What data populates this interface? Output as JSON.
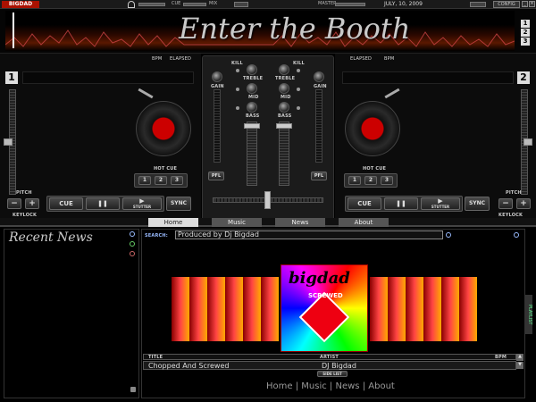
{
  "app": {
    "logo": "BIGDAD",
    "title": "Enter the Booth"
  },
  "topbar": {
    "cue_label": "CUE",
    "mix_label": "MIX",
    "master_label": "MASTER",
    "date": "JULY, 10, 2009",
    "config_label": "CONFIG"
  },
  "decks": {
    "left": {
      "number": "1",
      "bpm": "BPM",
      "elapsed": "ELAPSED",
      "gain": "GAIN",
      "hot_cue": "HOT CUE",
      "hot_cues": [
        "1",
        "2",
        "3"
      ],
      "pitch": "PITCH",
      "keylock": "KEYLOCK",
      "cue": "CUE",
      "pause": "❚❚",
      "play": "▶",
      "stutter": "STUTTER",
      "sync": "SYNC",
      "minus": "−",
      "plus": "+"
    },
    "right": {
      "number": "2",
      "bpm": "BPM",
      "elapsed": "ELAPSED",
      "gain": "GAIN",
      "hot_cue": "HOT CUE",
      "hot_cues": [
        "1",
        "2",
        "3"
      ],
      "pitch": "PITCH",
      "keylock": "KEYLOCK",
      "cue": "CUE",
      "pause": "❚❚",
      "play": "▶",
      "stutter": "STUTTER",
      "sync": "SYNC",
      "minus": "−",
      "plus": "+"
    }
  },
  "mixer": {
    "kill": "KILL",
    "treble": "TREBLE",
    "mid": "MID",
    "bass": "BASS",
    "pfl": "PFL"
  },
  "deck_selector": [
    "1",
    "2",
    "3"
  ],
  "tabs": [
    {
      "label": "Home"
    },
    {
      "label": "Music"
    },
    {
      "label": "News"
    },
    {
      "label": "About"
    }
  ],
  "news": {
    "title": "Recent News"
  },
  "search": {
    "label": "SEARCH:",
    "value": "Produced by Dj Bigdad"
  },
  "cover": {
    "title": "bigdad",
    "subtitle": "SCREWED"
  },
  "track_list": {
    "headers": {
      "title": "TITLE",
      "artist": "ARTIST",
      "bpm": "BPM"
    },
    "rows": [
      {
        "title": "Chopped And Screwed",
        "artist": "DJ Bigdad",
        "bpm": ""
      }
    ],
    "side_list": "SIDE LIST"
  },
  "playlist_tab": "PLAYLIST",
  "footer": {
    "home": "Home",
    "music": "Music",
    "news": "News",
    "about": "About",
    "sep": "|"
  },
  "colors": {
    "accent": "#cc1100",
    "panel": "#1b1b1b"
  }
}
